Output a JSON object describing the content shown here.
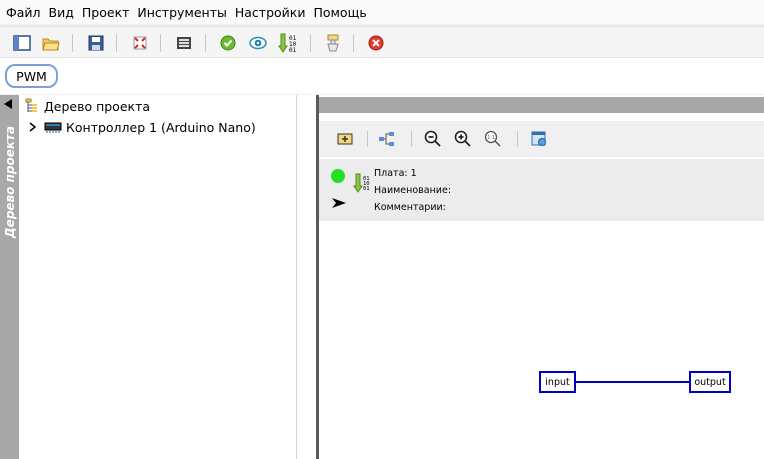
{
  "menu": {
    "items": [
      {
        "label": "Файл"
      },
      {
        "label": "Вид"
      },
      {
        "label": "Проект"
      },
      {
        "label": "Инструменты"
      },
      {
        "label": "Настройки"
      },
      {
        "label": "Помощь"
      }
    ]
  },
  "toolbar": {
    "icons": [
      "new-project-icon",
      "open-folder-icon",
      "save-icon",
      "fit-screen-icon",
      "board-settings-icon",
      "check-icon",
      "view-eye-icon",
      "upload-binary-icon",
      "clear-icon",
      "close-stop-icon"
    ]
  },
  "project_tab": {
    "label": "PWM"
  },
  "side_panel": {
    "label": "Дерево проекта"
  },
  "tree": {
    "root": {
      "label": "Дерево проекта",
      "icon": "project-tree-icon"
    },
    "children": [
      {
        "label": "Контроллер 1 (Arduino Nano)",
        "icon": "controller-chip-icon",
        "expanded": false
      }
    ]
  },
  "editor_toolbar": {
    "icons": [
      "add-block-icon",
      "hierarchy-icon",
      "zoom-out-icon",
      "zoom-in-icon",
      "zoom-reset-icon",
      "properties-icon"
    ]
  },
  "info": {
    "board": "Плата: 1",
    "name": "Наименование:",
    "comment": "Комментарии:",
    "status_color": "#22e022"
  },
  "canvas": {
    "blocks": [
      {
        "label": "input"
      },
      {
        "label": "output"
      }
    ],
    "wire_color": "#0000c0"
  }
}
